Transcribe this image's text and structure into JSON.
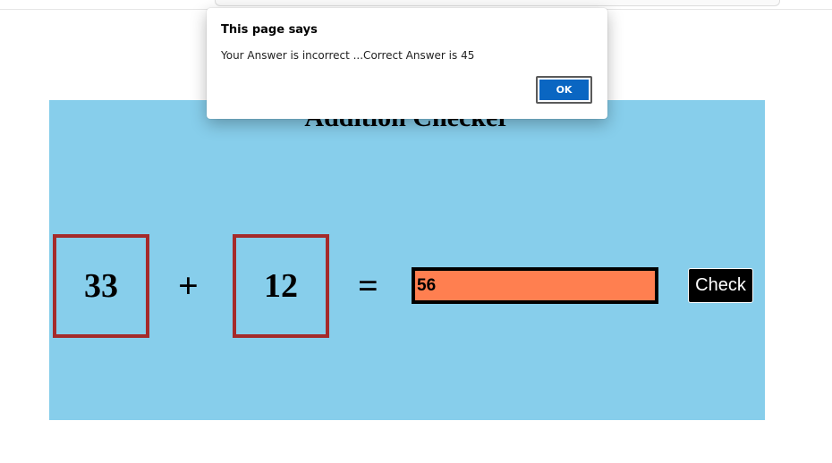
{
  "app": {
    "title": "Addition Checker",
    "first_number": "33",
    "operator": "+",
    "second_number": "12",
    "equals": "=",
    "answer_value": "56",
    "check_label": "Check"
  },
  "dialog": {
    "title": "This page says",
    "message": "Your Answer is incorrect ...Correct Answer is 45",
    "ok_label": "OK"
  },
  "colors": {
    "app_background": "#87ceeb",
    "number_box_border": "#a52a2a",
    "answer_background": "#ff7f50",
    "check_button": "#000000",
    "ok_button": "#0a66c2"
  }
}
